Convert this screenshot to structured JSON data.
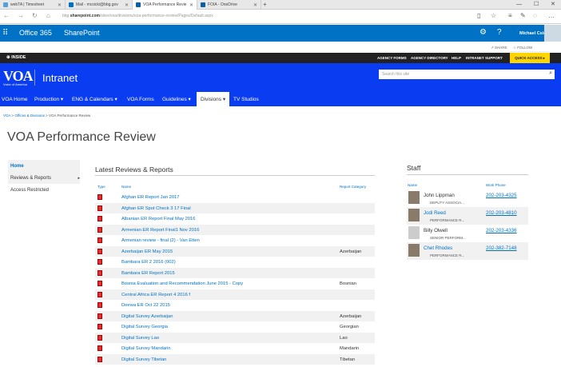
{
  "browser": {
    "tabs": [
      {
        "label": "webTA | Timesheet",
        "icon": "webta-icon",
        "color": "#5aa0d8"
      },
      {
        "label": "Mail - mcsicki@bbg.gov",
        "icon": "outlook-icon",
        "color": "#0072c6"
      },
      {
        "label": "VOA Performance Revie",
        "icon": "sharepoint-icon",
        "color": "#0a5fa8"
      },
      {
        "label": "FOIA - OneDrive",
        "icon": "onedrive-icon",
        "color": "#0a5fa8"
      }
    ],
    "url_prefix": "bbg.",
    "url_domain": "sharepoint.com",
    "url_rest": "/sites/voa/divisions/voa-performance-review/Pages/Default.aspx"
  },
  "suite": {
    "brand": "Office 365",
    "app": "SharePoint",
    "user": "Michael Csicki",
    "share": "SHARE",
    "follow": "FOLLOW"
  },
  "inside": {
    "logo": "INSIDE",
    "links": [
      "AGENCY FORMS",
      "AGENCY DIRECTORY",
      "HELP",
      "INTRANET SUPPORT"
    ],
    "quick_access": "QUICK ACCESS"
  },
  "header": {
    "logo": "VOA",
    "logo_sub": "Voice of America",
    "site_title": "Intranet",
    "search_placeholder": "Search this site"
  },
  "nav": [
    "VOA Home",
    "Production",
    "ENG & Calendars",
    "VOA Forms",
    "Guidelines",
    "Divisions",
    "TV Studios"
  ],
  "breadcrumb": {
    "a": "VOA",
    "b": "Offices & Divisions",
    "c": "VOA Performance Review"
  },
  "page_title": "VOA Performance Review",
  "leftnav": {
    "home": "Home",
    "reviews": "Reviews & Reports",
    "access": "Access Restricted"
  },
  "reports": {
    "title": "Latest Reviews & Reports",
    "headers": {
      "type": "Type",
      "name": "Name",
      "category": "Report Category"
    },
    "rows": [
      {
        "name": "Afghan ER Report Jan 2017",
        "category": ""
      },
      {
        "name": "Afghan ER Spot Check 3 17 Final",
        "category": ""
      },
      {
        "name": "Albanian ER Report Final May 2016",
        "category": ""
      },
      {
        "name": "Armenian ER Report Final1 Nov 2016",
        "category": ""
      },
      {
        "name": "Armenian review - final (2) - Van Etten",
        "category": ""
      },
      {
        "name": "Azerbaijan ER May 2015",
        "category": "Azerbaijan"
      },
      {
        "name": "Bambara ER 2 2016 (002)",
        "category": ""
      },
      {
        "name": "Bambara ER Report 2015",
        "category": ""
      },
      {
        "name": "Bosnia Evaluation and Recommendation June 2015 - Copy",
        "category": "Bosnian"
      },
      {
        "name": "Central Africa ER Report 4 2016 f",
        "category": ""
      },
      {
        "name": "Deewa ER Oct 22 2015",
        "category": ""
      },
      {
        "name": "Digital Survey Azerbaijan",
        "category": "Azerbaijan"
      },
      {
        "name": "Digital Survey Georgia",
        "category": "Georgian"
      },
      {
        "name": "Digital Survey Lao",
        "category": "Lao"
      },
      {
        "name": "Digital Survey Mandarin",
        "category": "Mandarin"
      },
      {
        "name": "Digital Survey Tibetan",
        "category": "Tibetan"
      }
    ]
  },
  "staff": {
    "title": "Staff",
    "headers": {
      "name": "Name",
      "phone": "Work Phone"
    },
    "rows": [
      {
        "name": "John Lippman",
        "title": "DEPUTY ASSOCIA...",
        "phone": "202-203-4325",
        "link": false
      },
      {
        "name": "Jodi Reed",
        "title": "PERFORMANCE R...",
        "phone": "202-203-4810",
        "link": true
      },
      {
        "name": "Billy Olwell",
        "title": "SENIOR PERFORM...",
        "phone": "202-203-4336",
        "link": false
      },
      {
        "name": "Chet Rhodes",
        "title": "PERFORMANCE R...",
        "phone": "202-382-7148",
        "link": true
      }
    ]
  },
  "colors": {
    "suite_blue": "#0072c6",
    "voa_blue": "#0a3cf2",
    "quick_access": "#ffd500"
  }
}
